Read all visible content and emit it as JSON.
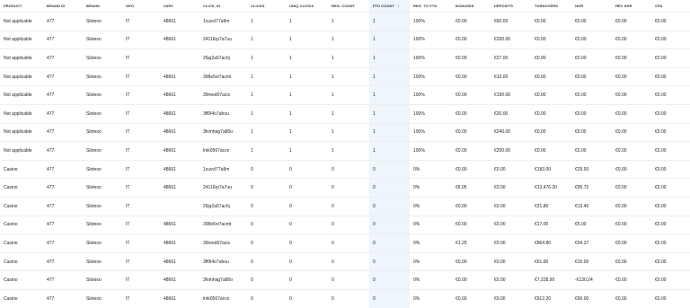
{
  "table": {
    "columns": [
      "PRODUCT",
      "BRAND ID",
      "BRAND",
      "GEO",
      "VAR1",
      "CLICK_ID",
      "CLICKS",
      "UNIQ CLICKS",
      "REG. COUNT",
      "FTD COUNT",
      "REG. TO FTD",
      "BONUSES",
      "DEPOSITS",
      "TURNOVERS",
      "NGR",
      "REV SHR",
      "CPA"
    ],
    "sort_icon": "arrow-down-icon",
    "rows": [
      [
        "Not applicable",
        "477",
        "Slotexo",
        "IT",
        "48661",
        "1cuvcl77a9m",
        "1",
        "1",
        "1",
        "1",
        "100%",
        "€0.00",
        "€60.00",
        "€0.00",
        "€0.00",
        "€0.00",
        "€0.00"
      ],
      [
        "Not applicable",
        "477",
        "Slotexo",
        "IT",
        "48661",
        "24116rp7a7uu",
        "1",
        "1",
        "1",
        "1",
        "100%",
        "€0.00",
        "€200.00",
        "€0.00",
        "€0.00",
        "€0.00",
        "€0.00"
      ],
      [
        "Not applicable",
        "477",
        "Slotexo",
        "IT",
        "",
        "26jq2a57achj",
        "1",
        "1",
        "1",
        "1",
        "100%",
        "€0.00",
        "€27.00",
        "€0.00",
        "€0.00",
        "€0.00",
        "€0.00"
      ],
      [
        "Not applicable",
        "477",
        "Slotexo",
        "IT",
        "48661",
        "398e5vt7acmt",
        "1",
        "1",
        "1",
        "1",
        "100%",
        "€0.00",
        "€10.00",
        "€0.00",
        "€0.00",
        "€0.00",
        "€0.00"
      ],
      [
        "Not applicable",
        "477",
        "Slotexo",
        "IT",
        "48661",
        "39reed07acis",
        "1",
        "1",
        "1",
        "1",
        "100%",
        "€0.00",
        "€190.00",
        "€0.00",
        "€0.00",
        "€0.00",
        "€0.00"
      ],
      [
        "Not applicable",
        "477",
        "Slotexo",
        "IT",
        "48661",
        "3ff0l4o7ahou",
        "1",
        "1",
        "1",
        "1",
        "100%",
        "€0.00",
        "€20.00",
        "€0.00",
        "€0.00",
        "€0.00",
        "€0.00"
      ],
      [
        "Not applicable",
        "477",
        "Slotexo",
        "IT",
        "48661",
        "3fvmhag7a80o",
        "1",
        "1",
        "1",
        "1",
        "100%",
        "€0.00",
        "€240.00",
        "€0.00",
        "€0.00",
        "€0.00",
        "€0.00"
      ],
      [
        "Not applicable",
        "477",
        "Slotexo",
        "IT",
        "48661",
        "lmk0567acvs",
        "1",
        "1",
        "1",
        "1",
        "100%",
        "€0.00",
        "€200.00",
        "€0.00",
        "€0.00",
        "€0.00",
        "€0.00"
      ],
      [
        "Casino",
        "477",
        "Slotexo",
        "IT",
        "48661",
        "1cuvcl77a9m",
        "0",
        "0",
        "0",
        "0",
        "0%",
        "€0.00",
        "€0.00",
        "€183.00",
        "€29.93",
        "€0.00",
        "€0.00"
      ],
      [
        "Casino",
        "477",
        "Slotexo",
        "IT",
        "48661",
        "24116rp7a7uu",
        "0",
        "0",
        "0",
        "0",
        "0%",
        "€6.05",
        "€0.00",
        "€13,476.20",
        "€95.72",
        "€0.00",
        "€0.00"
      ],
      [
        "Casino",
        "477",
        "Slotexo",
        "IT",
        "",
        "26jq2a57achj",
        "0",
        "0",
        "0",
        "0",
        "0%",
        "€0.00",
        "€0.00",
        "€31.80",
        "€13.40",
        "€0.00",
        "€0.00"
      ],
      [
        "Casino",
        "477",
        "Slotexo",
        "IT",
        "48661",
        "398e5vt7acmt",
        "0",
        "0",
        "0",
        "0",
        "0%",
        "€0.00",
        "€0.00",
        "€17.00",
        "€5.00",
        "€0.00",
        "€0.00"
      ],
      [
        "Casino",
        "477",
        "Slotexo",
        "IT",
        "48661",
        "39reed07acis",
        "0",
        "0",
        "0",
        "0",
        "0%",
        "€1.25",
        "€0.00",
        "€864.80",
        "€94.37",
        "€0.00",
        "€0.00"
      ],
      [
        "Casino",
        "477",
        "Slotexo",
        "IT",
        "48661",
        "3ff0l4o7ahou",
        "0",
        "0",
        "0",
        "0",
        "0%",
        "€0.00",
        "€0.00",
        "€61.90",
        "€10.00",
        "€0.00",
        "€0.00"
      ],
      [
        "Casino",
        "477",
        "Slotexo",
        "IT",
        "48661",
        "3fvmhag7a80o",
        "0",
        "0",
        "0",
        "0",
        "0%",
        "€0.00",
        "€0.00",
        "€7,228.90",
        "-€130.24",
        "€0.00",
        "€0.00"
      ],
      [
        "Casino",
        "477",
        "Slotexo",
        "IT",
        "48661",
        "lmk0567acvs",
        "0",
        "0",
        "0",
        "0",
        "0%",
        "€0.00",
        "€0.00",
        "€912.20",
        "€90.00",
        "€0.00",
        "€0.00"
      ]
    ]
  }
}
